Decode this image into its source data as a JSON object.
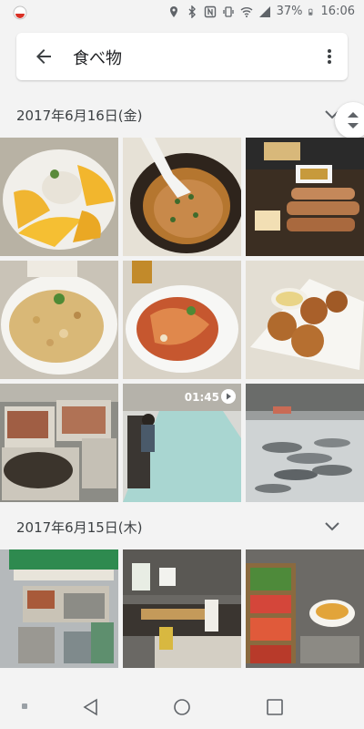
{
  "status_bar": {
    "battery": "37%",
    "time": "16:06"
  },
  "appbar": {
    "title": "食べ物"
  },
  "sections": [
    {
      "date": "2017年6月16日(金)"
    },
    {
      "date": "2017年6月15日(木)"
    }
  ],
  "video": {
    "duration": "01:45"
  },
  "colors": {
    "background": "#f3f3f3",
    "accent": "#1a73e8"
  },
  "icons": {
    "back": "arrow-back-icon",
    "more": "more-vert-icon",
    "chevron": "chevron-down-icon"
  }
}
